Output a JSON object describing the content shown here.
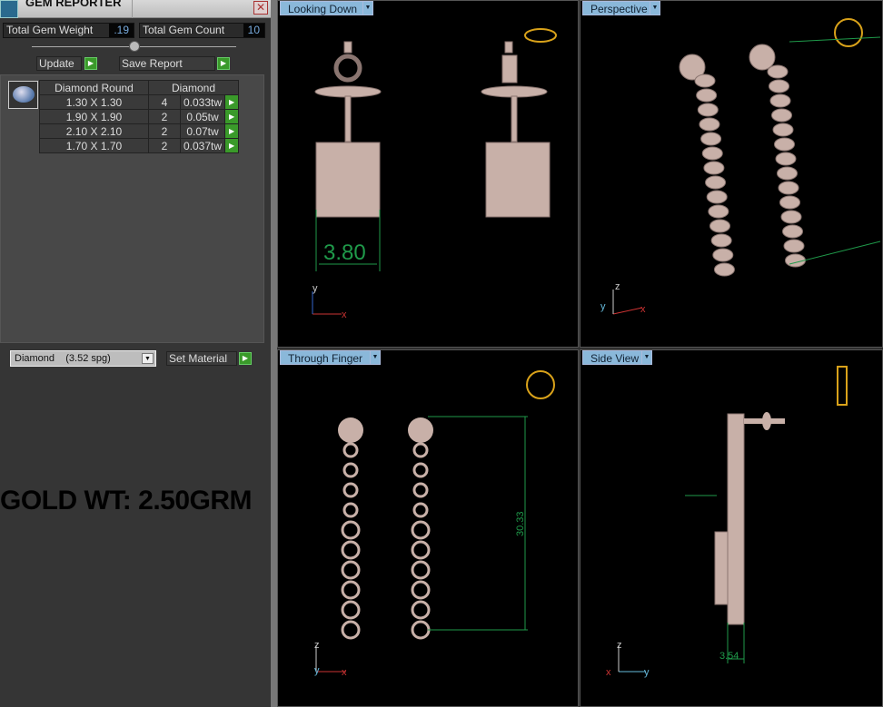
{
  "panel": {
    "title": "GEM REPORTER",
    "close": "✕",
    "total_weight_label": "Total Gem Weight",
    "total_weight": ".19",
    "total_count_label": "Total Gem Count",
    "total_count": "10",
    "update": "Update",
    "save_report": "Save Report",
    "go": "▶"
  },
  "table": {
    "headers": [
      "Diamond Round",
      "Diamond"
    ],
    "rows": [
      {
        "size": "1.30 X 1.30",
        "count": "4",
        "weight": "0.033tw"
      },
      {
        "size": "1.90 X 1.90",
        "count": "2",
        "weight": "0.05tw"
      },
      {
        "size": "2.10 X 2.10",
        "count": "2",
        "weight": "0.07tw"
      },
      {
        "size": "1.70 X 1.70",
        "count": "2",
        "weight": "0.037tw"
      }
    ]
  },
  "material": {
    "selected": "Diamond    (3.52 spg)",
    "set_label": "Set Material"
  },
  "overlay": "GOLD WT: 2.50GRM",
  "viewports": [
    {
      "label": "Looking Down",
      "dimension": "3.80",
      "axes": [
        "y",
        "x"
      ]
    },
    {
      "label": "Perspective",
      "axes": [
        "z",
        "y",
        "x"
      ]
    },
    {
      "label": "Through Finger",
      "dimension": "30.33",
      "axes": [
        "z",
        "y",
        "x"
      ]
    },
    {
      "label": "Side View",
      "dimension": "3.54",
      "axes": [
        "z",
        "x",
        "y"
      ]
    }
  ],
  "colors": {
    "dim": "#1f9a4a",
    "metal": "#c8b0a8",
    "label": "#8ab8da"
  }
}
